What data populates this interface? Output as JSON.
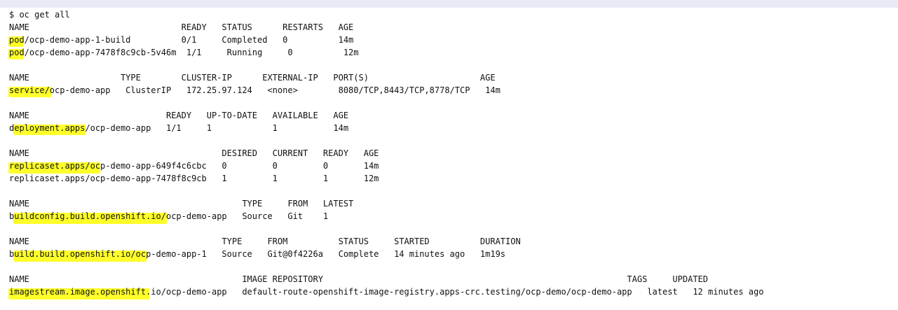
{
  "terminal": {
    "highlight_color": "#ffff2a",
    "lines": [
      {
        "id": "cmd",
        "text": "$ oc get all"
      },
      {
        "id": "pods-header",
        "text": "NAME                              READY   STATUS      RESTARTS   AGE"
      },
      {
        "id": "pod-build",
        "text": "pod/ocp-demo-app-1-build          0/1     Completed   0          14m"
      },
      {
        "id": "pod-running",
        "text": "pod/ocp-demo-app-7478f8c9cb-5v46m  1/1     Running     0          12m"
      },
      {
        "id": "blank-1",
        "text": ""
      },
      {
        "id": "svc-header",
        "text": "NAME                  TYPE        CLUSTER-IP      EXTERNAL-IP   PORT(S)                      AGE"
      },
      {
        "id": "svc-row",
        "text": "service/ocp-demo-app   ClusterIP   172.25.97.124   <none>        8080/TCP,8443/TCP,8778/TCP   14m"
      },
      {
        "id": "blank-2",
        "text": ""
      },
      {
        "id": "deploy-header",
        "text": "NAME                           READY   UP-TO-DATE   AVAILABLE   AGE"
      },
      {
        "id": "deploy-row",
        "text": "deployment.apps/ocp-demo-app   1/1     1            1           14m"
      },
      {
        "id": "blank-3",
        "text": ""
      },
      {
        "id": "rs-header",
        "text": "NAME                                      DESIRED   CURRENT   READY   AGE"
      },
      {
        "id": "rs-row-1",
        "text": "replicaset.apps/ocp-demo-app-649f4c6cbc   0         0         0       14m"
      },
      {
        "id": "rs-row-2",
        "text": "replicaset.apps/ocp-demo-app-7478f8c9cb   1         1         1       12m"
      },
      {
        "id": "blank-4",
        "text": ""
      },
      {
        "id": "bc-header",
        "text": "NAME                                          TYPE     FROM   LATEST"
      },
      {
        "id": "bc-row",
        "text": "buildconfig.build.openshift.io/ocp-demo-app   Source   Git    1"
      },
      {
        "id": "blank-5",
        "text": ""
      },
      {
        "id": "build-header",
        "text": "NAME                                      TYPE     FROM          STATUS     STARTED          DURATION"
      },
      {
        "id": "build-row",
        "text": "build.build.openshift.io/ocp-demo-app-1   Source   Git@0f4226a   Complete   14 minutes ago   1m19s"
      },
      {
        "id": "blank-6",
        "text": ""
      },
      {
        "id": "is-header",
        "text": "NAME                                          IMAGE REPOSITORY                                                            TAGS     UPDATED"
      },
      {
        "id": "is-row",
        "text": "imagestream.image.openshift.io/ocp-demo-app   default-route-openshift-image-registry.apps-crc.testing/ocp-demo/ocp-demo-app   latest   12 minutes ago"
      }
    ]
  }
}
